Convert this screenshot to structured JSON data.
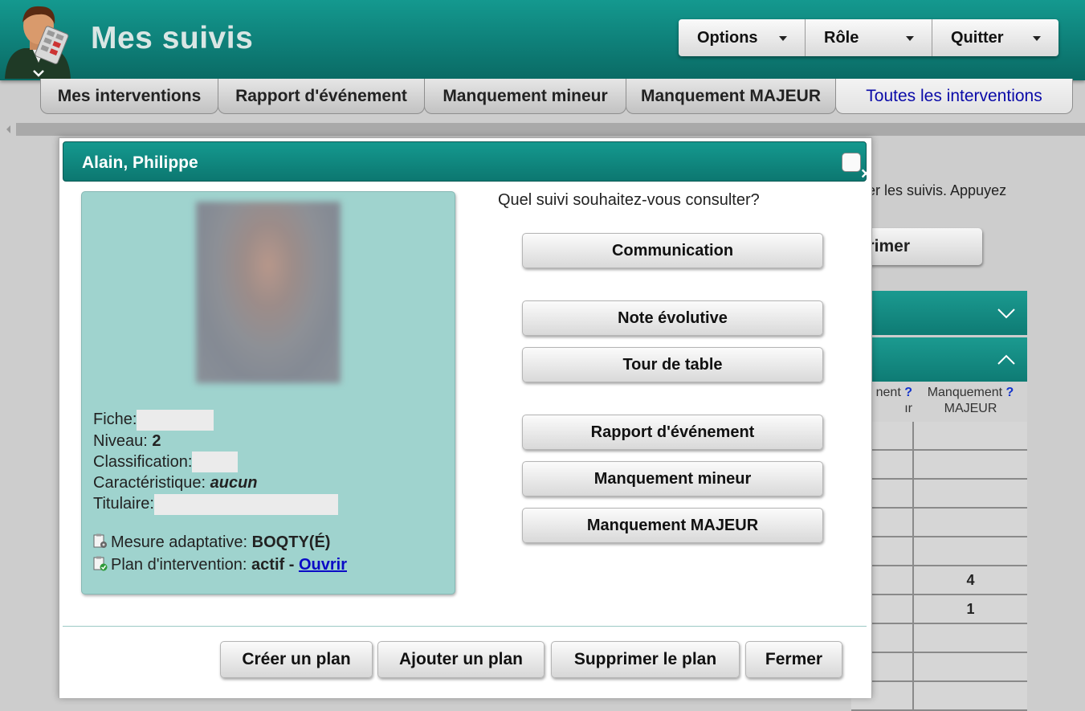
{
  "header": {
    "title": "Mes suivis",
    "menu": [
      {
        "label": "Options"
      },
      {
        "label": "Rôle"
      },
      {
        "label": "Quitter"
      }
    ]
  },
  "tabs": [
    {
      "label": "Mes interventions",
      "active": false
    },
    {
      "label": "Rapport d'événement",
      "active": false
    },
    {
      "label": "Manquement mineur",
      "active": false
    },
    {
      "label": "Manquement MAJEUR",
      "active": false
    },
    {
      "label": "Toutes les interventions",
      "active": true
    }
  ],
  "background": {
    "text_fragment": "er les suivis. Appuyez",
    "button_fragment": "rimer",
    "table_headers": {
      "col1": "nent",
      "col1_second_line": "ır",
      "col2": "Manquement",
      "col2_second_line": "MAJEUR",
      "help": "?"
    },
    "rows": [
      "",
      "",
      "",
      "",
      "",
      "4",
      "1",
      "",
      "",
      ""
    ]
  },
  "modal": {
    "title": "Alain, Philippe",
    "close_label": "×",
    "profile": {
      "fiche_label": "Fiche:",
      "niveau_label": "Niveau:",
      "niveau_value": "2",
      "classification_label": "Classification:",
      "caracteristique_label": "Caractéristique:",
      "caracteristique_value": "aucun",
      "titulaire_label": "Titulaire:",
      "mesure_label": "Mesure adaptative:",
      "mesure_value": "BOQTY(É)",
      "plan_label": "Plan d'intervention:",
      "plan_value": "actif -",
      "plan_link": "Ouvrir"
    },
    "question": "Quel suivi souhaitez-vous consulter?",
    "choices": [
      {
        "label": "Communication"
      },
      {
        "label": "Note évolutive"
      },
      {
        "label": "Tour de table"
      },
      {
        "label": "Rapport d'événement"
      },
      {
        "label": "Manquement mineur"
      },
      {
        "label": "Manquement MAJEUR"
      }
    ],
    "footer": [
      {
        "label": "Créer un plan"
      },
      {
        "label": "Ajouter un plan"
      },
      {
        "label": "Supprimer le plan"
      },
      {
        "label": "Fermer"
      }
    ]
  },
  "colors": {
    "header_teal": "#0e7f78",
    "profile_bg": "#9fd3ce",
    "link": "#0a0ac6",
    "active_tab_text": "#0a0aa8"
  }
}
